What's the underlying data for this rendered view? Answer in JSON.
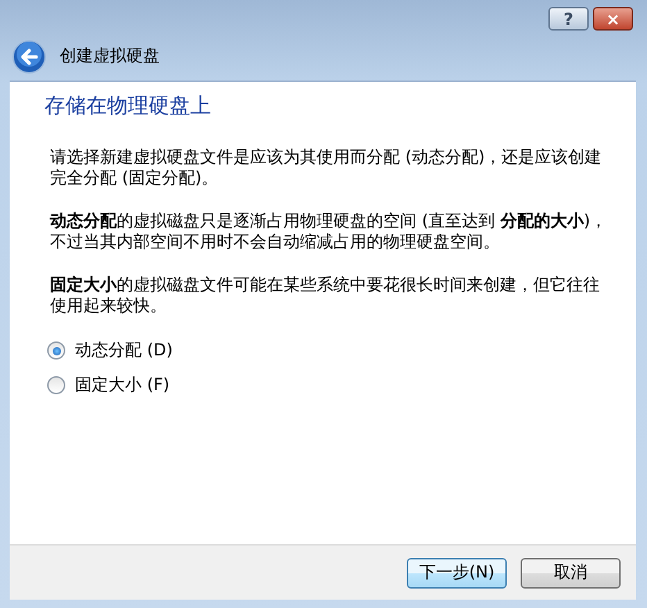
{
  "window": {
    "help_button": "?",
    "close_button": "×"
  },
  "header": {
    "title": "创建虚拟硬盘"
  },
  "page": {
    "heading": "存储在物理硬盘上",
    "paragraphs": [
      "请选择新建虚拟硬盘文件是应该为其使用而分配 (动态分配)，还是应该创建完全分配 (固定分配)。",
      "**动态分配**的虚拟磁盘只是逐渐占用物理硬盘的空间 (直至达到 **分配的大小**)，不过当其内部空间不用时不会自动缩减占用的物理硬盘空间。",
      "**固定大小**的虚拟磁盘文件可能在某些系统中要花很长时间来创建，但它往往使用起来较快。"
    ],
    "options": [
      {
        "label": "动态分配 (D)",
        "selected": true
      },
      {
        "label": "固定大小 (F)",
        "selected": false
      }
    ]
  },
  "buttons": [
    "下一步(N)",
    "取消"
  ]
}
